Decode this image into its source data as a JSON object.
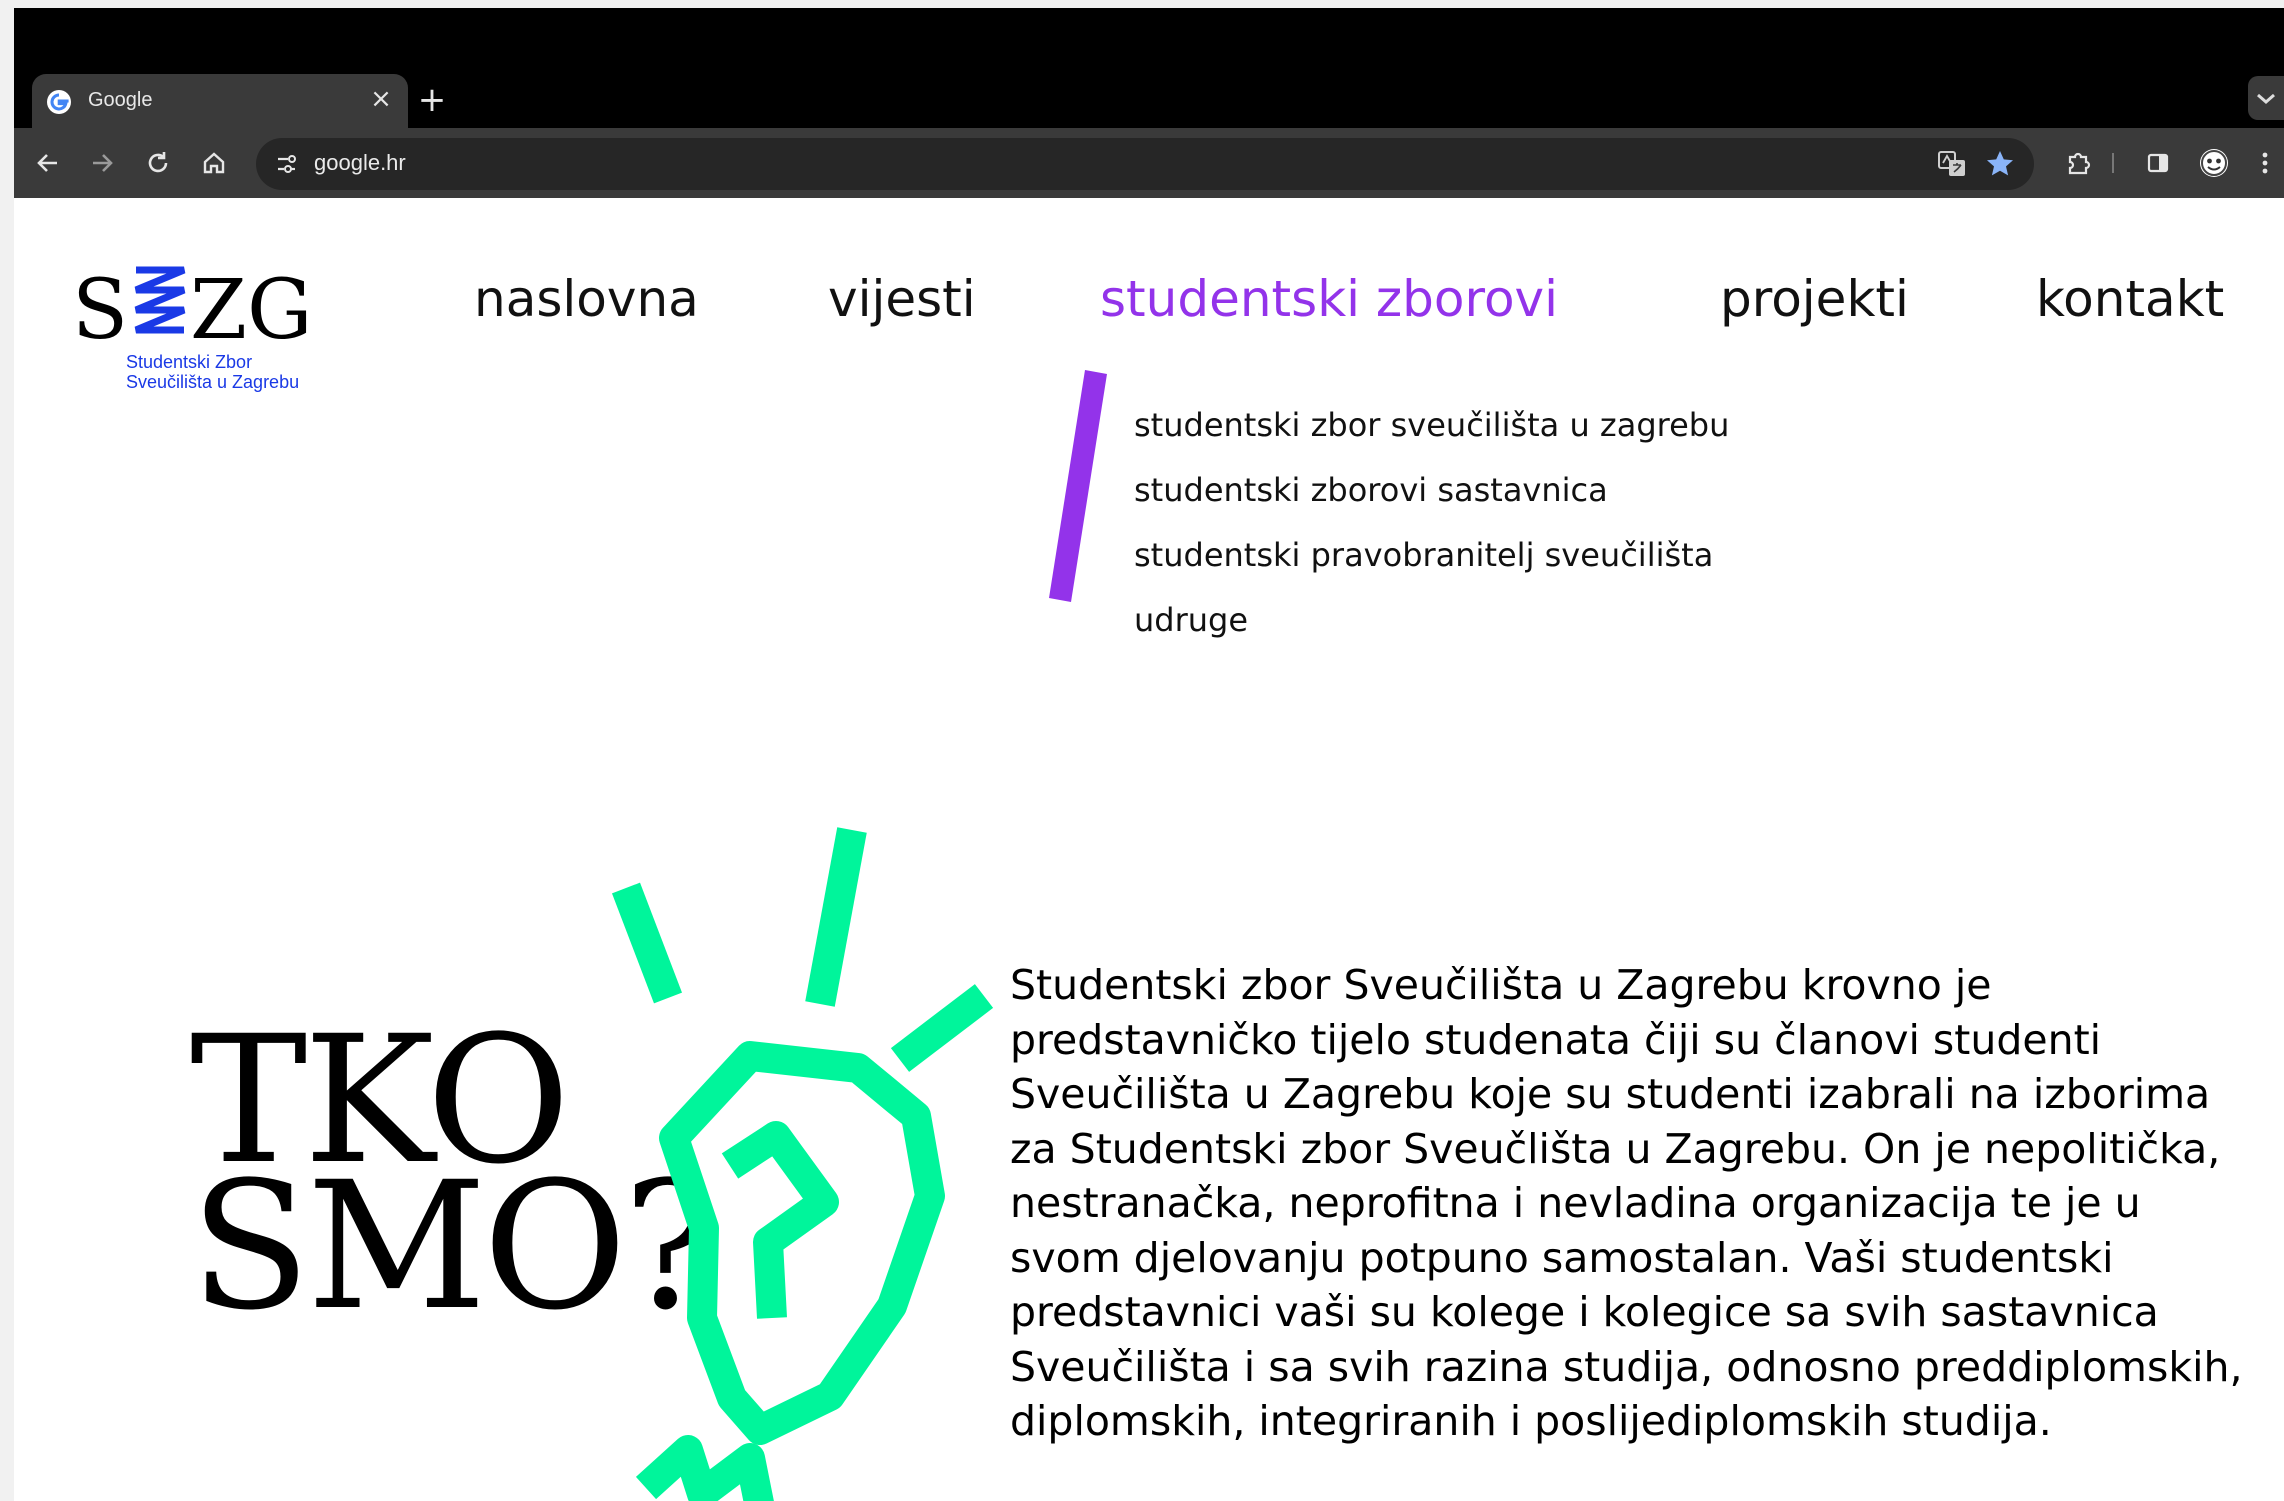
{
  "browser": {
    "tab": {
      "title": "Google",
      "favicon": "google-g-icon",
      "close_icon": "×"
    },
    "new_tab_icon": "+",
    "toolbar": {
      "url": "google.hr",
      "icons": [
        "back-arrow-icon",
        "forward-arrow-icon",
        "reload-icon",
        "home-icon",
        "site-info-icon",
        "translate-icon",
        "bookmark-star-icon",
        "extensions-icon",
        "side-panel-icon",
        "profile-avatar-icon",
        "menu-kebab-icon"
      ]
    }
  },
  "site": {
    "logo": {
      "mark": "SZZG",
      "line1": "Studentski Zbor",
      "line2": "Sveučilišta u Zagrebu"
    },
    "nav": [
      {
        "label": "naslovna",
        "active": false
      },
      {
        "label": "vijesti",
        "active": false
      },
      {
        "label": "studentski zborovi",
        "active": true
      },
      {
        "label": "projekti",
        "active": false
      },
      {
        "label": "kontakt",
        "active": false
      }
    ],
    "submenu": [
      "studentski zbor sveučilišta u zagrebu",
      "studentski zborovi sastavnica",
      "studentski pravobranitelj sveučilišta",
      "udruge"
    ],
    "hero": {
      "title_line1": "TKO",
      "title_line2": "SMO?"
    },
    "about": "Studentski zbor Sveučilišta u Zagrebu krovno je predstavničko tijelo studenata čiji su članovi studenti Sveučilišta u Zagrebu koje su studenti izabrali na izborima za Studentski zbor Sveučlišta u Zagrebu. On je nepolitička, nestranačka, neprofitna i nevladina organizacija te je u svom djelovanju potpuno samostalan. Vaši studentski predstavnici vaši su kolege i kolegice sa svih sastavnica Sveučilišta i sa svih razina studija, odnosno preddiplomskih, diplomskih, integriranih i poslijediplomskih studija."
  },
  "colors": {
    "accent_purple": "#9333ea",
    "logo_blue": "#1a39e6",
    "bulb_green": "#00f59b",
    "chrome_dark": "#3a3a3a",
    "bookmark_blue": "#8ab4f8"
  }
}
